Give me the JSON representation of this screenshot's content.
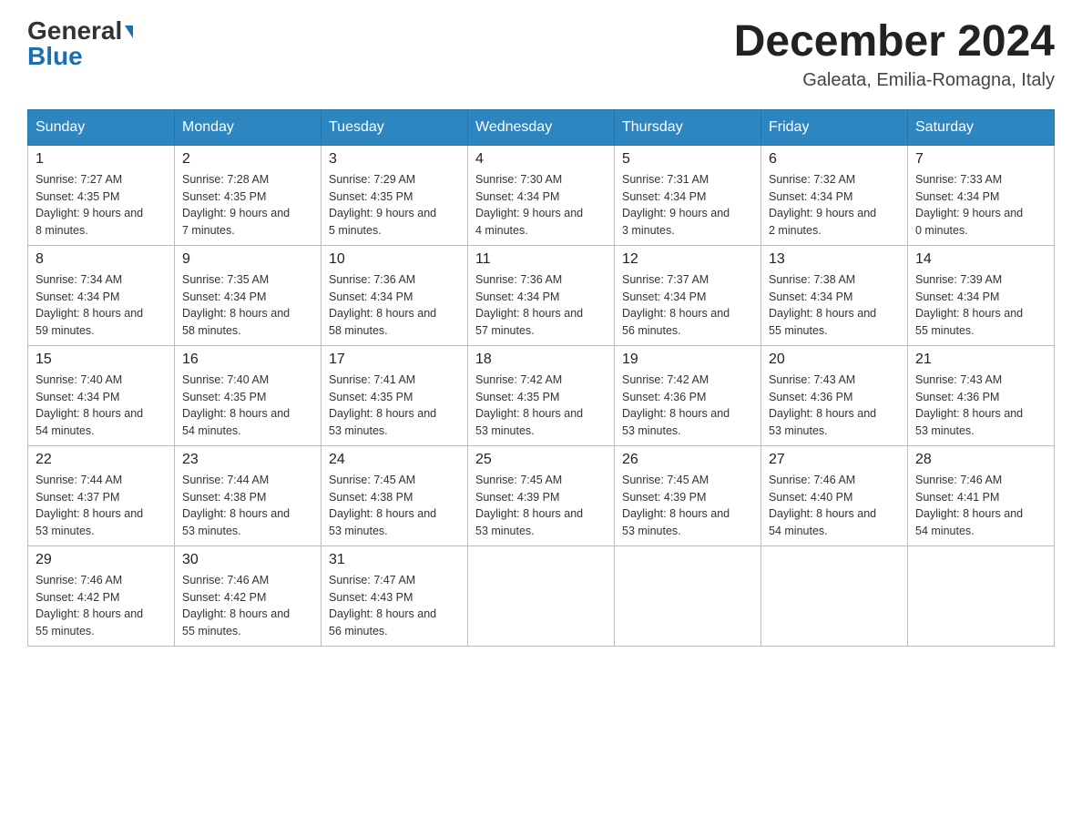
{
  "header": {
    "logo": {
      "general": "General",
      "blue": "Blue",
      "arrow": "▼"
    },
    "title": "December 2024",
    "location": "Galeata, Emilia-Romagna, Italy"
  },
  "days_of_week": [
    "Sunday",
    "Monday",
    "Tuesday",
    "Wednesday",
    "Thursday",
    "Friday",
    "Saturday"
  ],
  "weeks": [
    [
      {
        "day": "1",
        "sunrise": "7:27 AM",
        "sunset": "4:35 PM",
        "daylight": "9 hours and 8 minutes."
      },
      {
        "day": "2",
        "sunrise": "7:28 AM",
        "sunset": "4:35 PM",
        "daylight": "9 hours and 7 minutes."
      },
      {
        "day": "3",
        "sunrise": "7:29 AM",
        "sunset": "4:35 PM",
        "daylight": "9 hours and 5 minutes."
      },
      {
        "day": "4",
        "sunrise": "7:30 AM",
        "sunset": "4:34 PM",
        "daylight": "9 hours and 4 minutes."
      },
      {
        "day": "5",
        "sunrise": "7:31 AM",
        "sunset": "4:34 PM",
        "daylight": "9 hours and 3 minutes."
      },
      {
        "day": "6",
        "sunrise": "7:32 AM",
        "sunset": "4:34 PM",
        "daylight": "9 hours and 2 minutes."
      },
      {
        "day": "7",
        "sunrise": "7:33 AM",
        "sunset": "4:34 PM",
        "daylight": "9 hours and 0 minutes."
      }
    ],
    [
      {
        "day": "8",
        "sunrise": "7:34 AM",
        "sunset": "4:34 PM",
        "daylight": "8 hours and 59 minutes."
      },
      {
        "day": "9",
        "sunrise": "7:35 AM",
        "sunset": "4:34 PM",
        "daylight": "8 hours and 58 minutes."
      },
      {
        "day": "10",
        "sunrise": "7:36 AM",
        "sunset": "4:34 PM",
        "daylight": "8 hours and 58 minutes."
      },
      {
        "day": "11",
        "sunrise": "7:36 AM",
        "sunset": "4:34 PM",
        "daylight": "8 hours and 57 minutes."
      },
      {
        "day": "12",
        "sunrise": "7:37 AM",
        "sunset": "4:34 PM",
        "daylight": "8 hours and 56 minutes."
      },
      {
        "day": "13",
        "sunrise": "7:38 AM",
        "sunset": "4:34 PM",
        "daylight": "8 hours and 55 minutes."
      },
      {
        "day": "14",
        "sunrise": "7:39 AM",
        "sunset": "4:34 PM",
        "daylight": "8 hours and 55 minutes."
      }
    ],
    [
      {
        "day": "15",
        "sunrise": "7:40 AM",
        "sunset": "4:34 PM",
        "daylight": "8 hours and 54 minutes."
      },
      {
        "day": "16",
        "sunrise": "7:40 AM",
        "sunset": "4:35 PM",
        "daylight": "8 hours and 54 minutes."
      },
      {
        "day": "17",
        "sunrise": "7:41 AM",
        "sunset": "4:35 PM",
        "daylight": "8 hours and 53 minutes."
      },
      {
        "day": "18",
        "sunrise": "7:42 AM",
        "sunset": "4:35 PM",
        "daylight": "8 hours and 53 minutes."
      },
      {
        "day": "19",
        "sunrise": "7:42 AM",
        "sunset": "4:36 PM",
        "daylight": "8 hours and 53 minutes."
      },
      {
        "day": "20",
        "sunrise": "7:43 AM",
        "sunset": "4:36 PM",
        "daylight": "8 hours and 53 minutes."
      },
      {
        "day": "21",
        "sunrise": "7:43 AM",
        "sunset": "4:36 PM",
        "daylight": "8 hours and 53 minutes."
      }
    ],
    [
      {
        "day": "22",
        "sunrise": "7:44 AM",
        "sunset": "4:37 PM",
        "daylight": "8 hours and 53 minutes."
      },
      {
        "day": "23",
        "sunrise": "7:44 AM",
        "sunset": "4:38 PM",
        "daylight": "8 hours and 53 minutes."
      },
      {
        "day": "24",
        "sunrise": "7:45 AM",
        "sunset": "4:38 PM",
        "daylight": "8 hours and 53 minutes."
      },
      {
        "day": "25",
        "sunrise": "7:45 AM",
        "sunset": "4:39 PM",
        "daylight": "8 hours and 53 minutes."
      },
      {
        "day": "26",
        "sunrise": "7:45 AM",
        "sunset": "4:39 PM",
        "daylight": "8 hours and 53 minutes."
      },
      {
        "day": "27",
        "sunrise": "7:46 AM",
        "sunset": "4:40 PM",
        "daylight": "8 hours and 54 minutes."
      },
      {
        "day": "28",
        "sunrise": "7:46 AM",
        "sunset": "4:41 PM",
        "daylight": "8 hours and 54 minutes."
      }
    ],
    [
      {
        "day": "29",
        "sunrise": "7:46 AM",
        "sunset": "4:42 PM",
        "daylight": "8 hours and 55 minutes."
      },
      {
        "day": "30",
        "sunrise": "7:46 AM",
        "sunset": "4:42 PM",
        "daylight": "8 hours and 55 minutes."
      },
      {
        "day": "31",
        "sunrise": "7:47 AM",
        "sunset": "4:43 PM",
        "daylight": "8 hours and 56 minutes."
      },
      null,
      null,
      null,
      null
    ]
  ],
  "labels": {
    "sunrise": "Sunrise:",
    "sunset": "Sunset:",
    "daylight": "Daylight:"
  }
}
